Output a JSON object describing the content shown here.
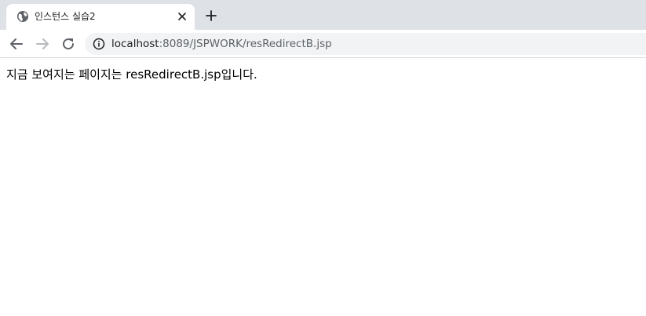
{
  "tab": {
    "title": "인스턴스 실습2",
    "favicon": "globe-icon",
    "close_icon": "close-icon"
  },
  "toolbar": {
    "new_tab_icon": "plus-icon",
    "back_icon": "arrow-left-icon",
    "forward_icon": "arrow-right-icon",
    "reload_icon": "reload-icon",
    "info_icon": "info-icon"
  },
  "address": {
    "host": "localhost",
    "path": ":8089/JSPWORK/resRedirectB.jsp"
  },
  "page": {
    "text": "지금 보여지는 페이지는 resRedirectB.jsp입니다."
  },
  "colors": {
    "tabstrip": "#dee1e6",
    "omnibox": "#f1f3f4",
    "icon": "#5f6368",
    "icon_disabled": "#b7babe"
  }
}
